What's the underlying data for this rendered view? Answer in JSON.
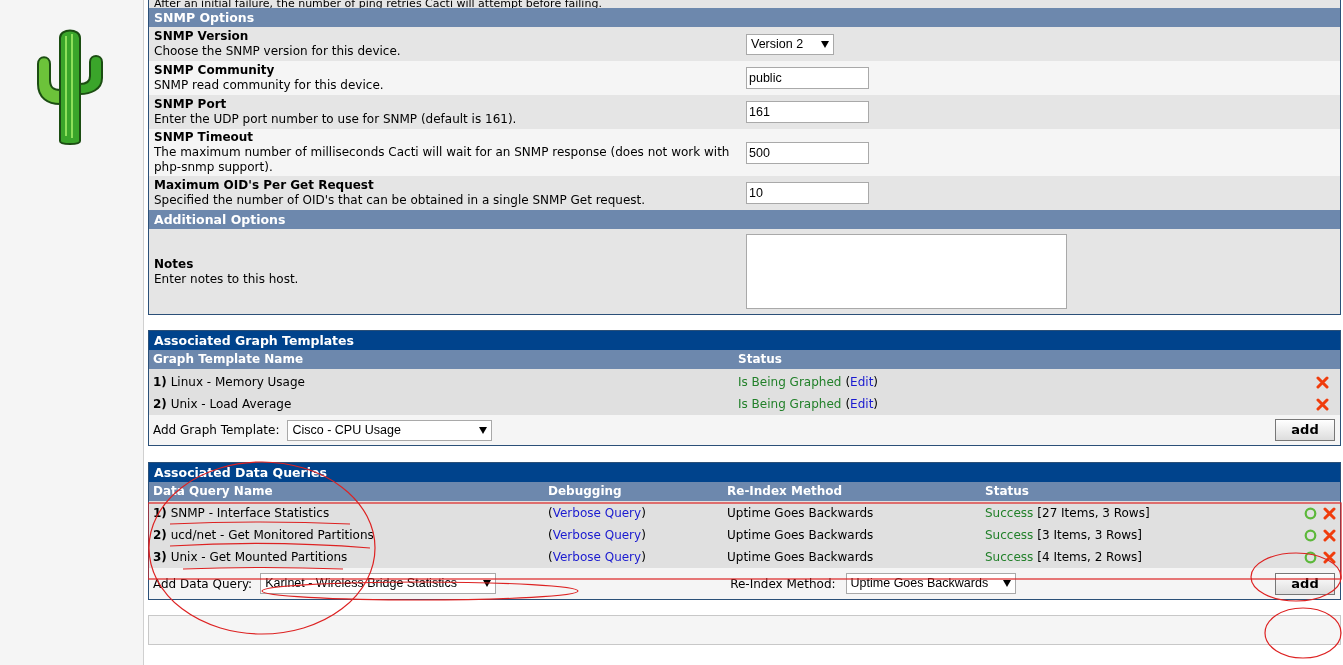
{
  "top_description": "After an initial failure, the number of ping retries Cacti will attempt before failing.",
  "device_form": {
    "sections": [
      {
        "title": "SNMP Options",
        "fields": [
          {
            "kind": "select",
            "label": "SNMP Version",
            "description": "Choose the SNMP version for this device.",
            "value": "Version 2"
          },
          {
            "kind": "text",
            "label": "SNMP Community",
            "description": "SNMP read community for this device.",
            "value": "public"
          },
          {
            "kind": "text",
            "label": "SNMP Port",
            "description": "Enter the UDP port number to use for SNMP (default is 161).",
            "value": "161"
          },
          {
            "kind": "text",
            "label": "SNMP Timeout",
            "description": "The maximum number of milliseconds Cacti will wait for an SNMP response (does not work with php-snmp support).",
            "value": "500"
          },
          {
            "kind": "text",
            "label": "Maximum OID's Per Get Request",
            "description": "Specified the number of OID's that can be obtained in a single SNMP Get request.",
            "value": "10"
          }
        ]
      },
      {
        "title": "Additional Options",
        "fields": [
          {
            "kind": "textarea",
            "label": "Notes",
            "description": "Enter notes to this host."
          }
        ]
      }
    ]
  },
  "graph_templates": {
    "title": "Associated Graph Templates",
    "columns": [
      "Graph Template Name",
      "Status"
    ],
    "rows": [
      {
        "index": "1)",
        "name": "Linux - Memory Usage",
        "status": "Is Being Graphed",
        "edit": [
          "(",
          "Edit",
          ")"
        ]
      },
      {
        "index": "2)",
        "name": "Unix - Load Average",
        "status": "Is Being Graphed",
        "edit": [
          "(",
          "Edit",
          ")"
        ]
      }
    ],
    "add_label": "Add Graph Template:",
    "add_select": "Cisco - CPU Usage",
    "add_button": "add"
  },
  "data_queries": {
    "title": "Associated Data Queries",
    "columns": [
      "Data Query Name",
      "Debugging",
      "Re-Index Method",
      "Status"
    ],
    "rows": [
      {
        "index": "1)",
        "name": "SNMP - Interface Statistics",
        "debug": [
          "(",
          "Verbose Query",
          ")"
        ],
        "reindex": "Uptime Goes Backwards",
        "status": "Success",
        "detail": "[27 Items, 3 Rows]"
      },
      {
        "index": "2)",
        "name": "ucd/net - Get Monitored Partitions",
        "debug": [
          "(",
          "Verbose Query",
          ")"
        ],
        "reindex": "Uptime Goes Backwards",
        "status": "Success",
        "detail": "[3 Items, 3 Rows]"
      },
      {
        "index": "3)",
        "name": "Unix - Get Mounted Partitions",
        "debug": [
          "(",
          "Verbose Query",
          ")"
        ],
        "reindex": "Uptime Goes Backwards",
        "status": "Success",
        "detail": "[4 Items, 2 Rows]"
      }
    ],
    "add_label": "Add Data Query:",
    "add_select": "Karlnet - Wireless Bridge Statistics",
    "reindex_label": "Re-Index Method:",
    "reindex_select": "Uptime Goes Backwards",
    "add_button": "add"
  }
}
